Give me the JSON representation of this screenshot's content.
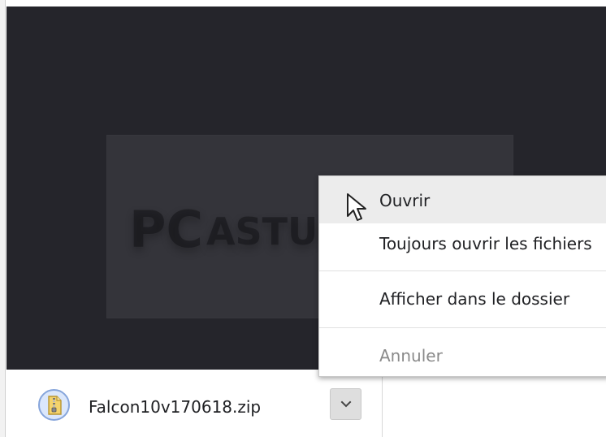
{
  "content": {
    "watermark": {
      "logo_text_pc": "PC",
      "logo_text_astuces": "ASTUCES"
    }
  },
  "downloads": {
    "file_name": "Falcon10v170618.zip",
    "file_icon": "zip-file-icon",
    "menu_toggle_icon": "chevron-down-icon"
  },
  "context_menu": {
    "items": [
      {
        "label": "Ouvrir",
        "state": "hovered"
      },
      {
        "label": "Toujours ouvrir les fichiers"
      },
      {
        "label": "Afficher dans le dossier"
      },
      {
        "label": "Annuler",
        "state": "disabled"
      }
    ]
  },
  "cursor": {
    "icon": "arrow-cursor-icon"
  },
  "colors": {
    "content_background": "#25252b",
    "menu_background": "#ffffff",
    "menu_hover": "#ececec",
    "download_icon_ring": "#86a5db",
    "disabled_text": "#8a8a8a"
  }
}
